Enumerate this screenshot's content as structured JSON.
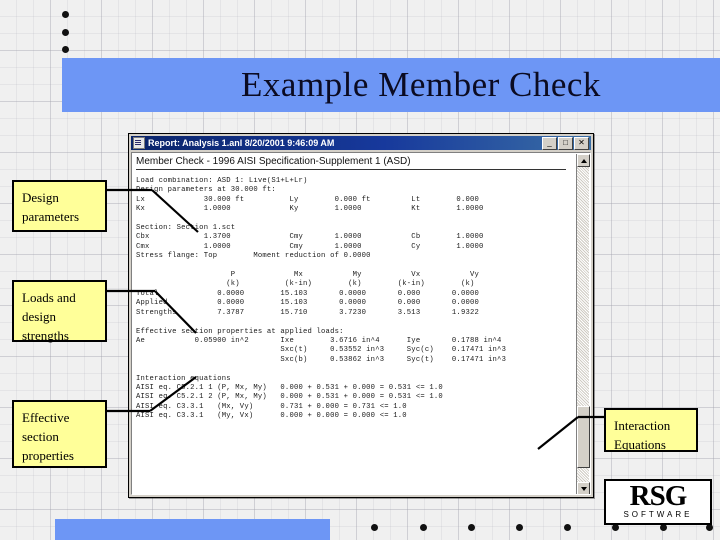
{
  "slide": {
    "title": "Example Member Check",
    "accent_color": "#6d96f5",
    "callout_fill": "#ffff99",
    "background": "grid-paper"
  },
  "bullet_dots": {
    "vertical_count": 3,
    "horizontal_count": 8
  },
  "report_window": {
    "title": "Report: Analysis 1.anl 8/20/2001 9:46:09 AM",
    "icon": "document-icon",
    "buttons": {
      "minimize": "_",
      "maximize": "□",
      "close": "✕"
    },
    "document_header": "Member Check - 1996 AISI Specification-Supplement 1 (ASD)",
    "body_text": "Load combination: ASD 1: Live(S1+L+Lr)\nDesign parameters at 30.000 ft:\nLx             30.000 ft          Ly        0.000 ft         Lt        0.000\nKx             1.0000             Ky        1.0000           Kt        1.0000\n\nSection: Section 1.sct\nCbx            1.3700             Cmy       1.0000           Cb        1.0000\nCmx            1.0000             Cmy       1.0000           Cy        1.0000\nStress flange: Top        Moment reduction of 0.0000\n\n                     P             Mx           My           Vx           Vy\n                    (k)          (k-in)        (k)        (k-in)        (k)\nTotal             0.0000        15.103       0.0000       0.000       0.0000\nApplied           0.0000        15.103       0.0000       0.000       0.0000\nStrengths         7.3787        15.710       3.7230       3.513       1.9322\n\nEffective section properties at applied loads:\nAe           0.05900 in^2       Ixe        3.6716 in^4      Iye       0.1788 in^4\n                                Sxc(t)     0.53552 in^3     Syc(c)    0.17471 in^3\n                                Sxc(b)     0.53862 in^3     Syc(t)    0.17471 in^3\n\nInteraction equations\nAISI eq. C5.2.1 1 (P, Mx, My)   0.000 + 0.531 + 0.000 = 0.531 <= 1.0\nAISI eq. C5.2.1 2 (P, Mx, My)   0.000 + 0.531 + 0.000 = 0.531 <= 1.0\nAISI eq. C3.3.1   (Mx, Vy)      0.731 + 0.000 = 0.731 <= 1.0\nAISI eq. C3.3.1   (My, Vx)      0.000 + 0.000 = 0.000 <= 1.0",
    "scrollbar": {
      "up_arrow": "▲",
      "down_arrow": "▼"
    }
  },
  "callouts": {
    "design": "Design parameters",
    "loads": "Loads and design strengths",
    "effective": "Effective section properties",
    "interaction": "Interaction Equations"
  },
  "logo": {
    "main": "RSG",
    "sub": "SOFTWARE"
  }
}
